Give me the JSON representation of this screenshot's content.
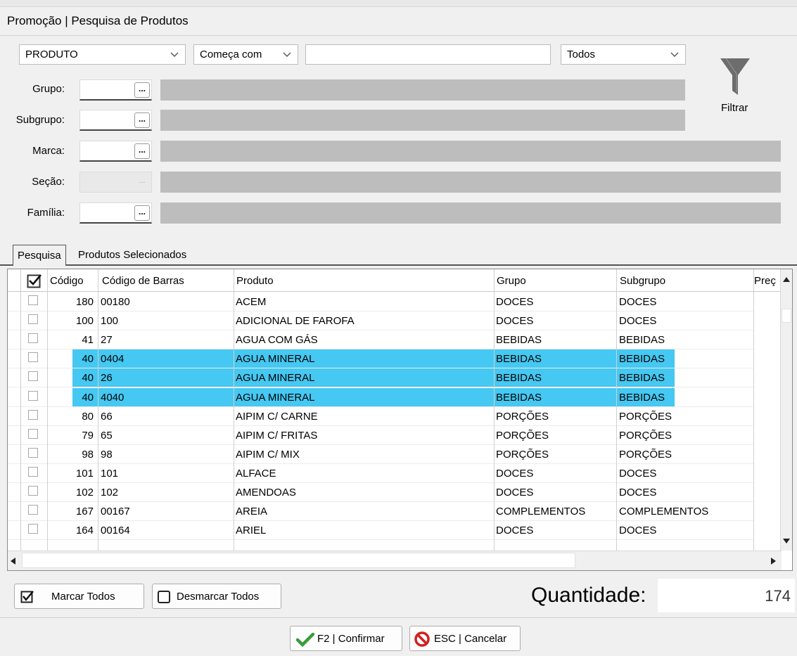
{
  "window": {
    "title": "Promoção | Pesquisa de Produtos"
  },
  "search": {
    "field_value": "PRODUTO",
    "mode_value": "Começa com",
    "text_value": "",
    "status_value": "Todos"
  },
  "filters": {
    "grupo_label": "Grupo:",
    "subgrupo_label": "Subgrupo:",
    "marca_label": "Marca:",
    "secao_label": "Seção:",
    "familia_label": "Família:",
    "dots": "..."
  },
  "filter_button": {
    "label": "Filtrar",
    "icon": "funnel-icon"
  },
  "tabs": [
    {
      "label": "Pesquisa"
    },
    {
      "label": "Produtos Selecionados"
    }
  ],
  "grid": {
    "headers": {
      "codigo": "Código",
      "barras": "Código de Barras",
      "produto": "Produto",
      "grupo": "Grupo",
      "subgrupo": "Subgrupo",
      "preco": "Preç"
    },
    "rows": [
      {
        "codigo": "180",
        "barras": "00180",
        "produto": "ACEM",
        "grupo": "DOCES",
        "subgrupo": "DOCES",
        "selected": false
      },
      {
        "codigo": "100",
        "barras": "100",
        "produto": "ADICIONAL DE FAROFA",
        "grupo": "DOCES",
        "subgrupo": "DOCES",
        "selected": false
      },
      {
        "codigo": "41",
        "barras": "27",
        "produto": "AGUA COM GÁS",
        "grupo": "BEBIDAS",
        "subgrupo": "BEBIDAS",
        "selected": false
      },
      {
        "codigo": "40",
        "barras": "0404",
        "produto": "AGUA MINERAL",
        "grupo": "BEBIDAS",
        "subgrupo": "BEBIDAS",
        "selected": true
      },
      {
        "codigo": "40",
        "barras": "26",
        "produto": "AGUA MINERAL",
        "grupo": "BEBIDAS",
        "subgrupo": "BEBIDAS",
        "selected": true
      },
      {
        "codigo": "40",
        "barras": "4040",
        "produto": "AGUA MINERAL",
        "grupo": "BEBIDAS",
        "subgrupo": "BEBIDAS",
        "selected": true
      },
      {
        "codigo": "80",
        "barras": "66",
        "produto": "AIPIM C/ CARNE",
        "grupo": "PORÇÕES",
        "subgrupo": "PORÇÕES",
        "selected": false
      },
      {
        "codigo": "79",
        "barras": "65",
        "produto": "AIPIM C/ FRITAS",
        "grupo": "PORÇÕES",
        "subgrupo": "PORÇÕES",
        "selected": false
      },
      {
        "codigo": "98",
        "barras": "98",
        "produto": "AIPIM C/ MIX",
        "grupo": "PORÇÕES",
        "subgrupo": "PORÇÕES",
        "selected": false
      },
      {
        "codigo": "101",
        "barras": "101",
        "produto": "ALFACE",
        "grupo": "DOCES",
        "subgrupo": "DOCES",
        "selected": false
      },
      {
        "codigo": "102",
        "barras": "102",
        "produto": "AMENDOAS",
        "grupo": "DOCES",
        "subgrupo": "DOCES",
        "selected": false
      },
      {
        "codigo": "167",
        "barras": "00167",
        "produto": "AREIA",
        "grupo": "COMPLEMENTOS",
        "subgrupo": "COMPLEMENTOS",
        "selected": false
      },
      {
        "codigo": "164",
        "barras": "00164",
        "produto": "ARIEL",
        "grupo": "DOCES",
        "subgrupo": "DOCES",
        "selected": false
      }
    ],
    "selection_color": "#45c8f2"
  },
  "actions": {
    "marcar_todos": "Marcar Todos",
    "desmarcar_todos": "Desmarcar Todos",
    "quantidade_label": "Quantidade:",
    "quantidade_value": "174",
    "confirmar": "F2 | Confirmar",
    "cancelar": "ESC | Cancelar"
  }
}
